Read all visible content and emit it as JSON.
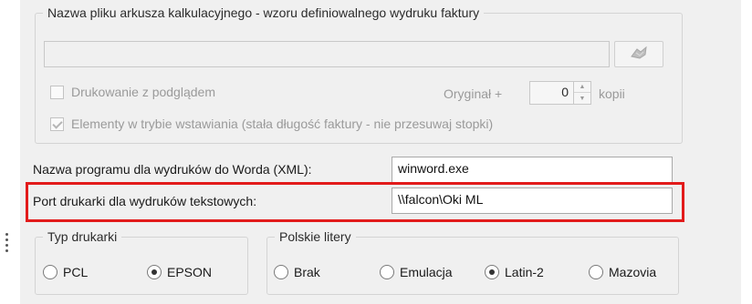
{
  "invoice_template": {
    "legend": "Nazwa pliku arkusza kalkulacyjnego - wzoru definiowalnego wydruku faktury",
    "file_value": "",
    "preview_label": "Drukowanie z podglądem",
    "original_label": "Oryginał +",
    "copies_value": "0",
    "copies_unit": "kopii",
    "insert_mode_label": "Elementy w trybie wstawiania (stała długość faktury - nie przesuwaj stopki)",
    "insert_mode_checked": true
  },
  "word_program": {
    "label": "Nazwa programu dla wydruków do Worda (XML):",
    "value": "winword.exe"
  },
  "text_printer_port": {
    "label": "Port drukarki dla wydruków tekstowych:",
    "value": "\\\\falcon\\Oki ML"
  },
  "printer_type": {
    "legend": "Typ drukarki",
    "options": [
      "PCL",
      "EPSON"
    ],
    "selected": "EPSON"
  },
  "polish_letters": {
    "legend": "Polskie litery",
    "options": [
      "Brak",
      "Emulacja",
      "Latin-2",
      "Mazovia"
    ],
    "selected": "Latin-2"
  },
  "colors": {
    "highlight": "#e21b1b",
    "panel_bg": "#f0f0f0"
  }
}
